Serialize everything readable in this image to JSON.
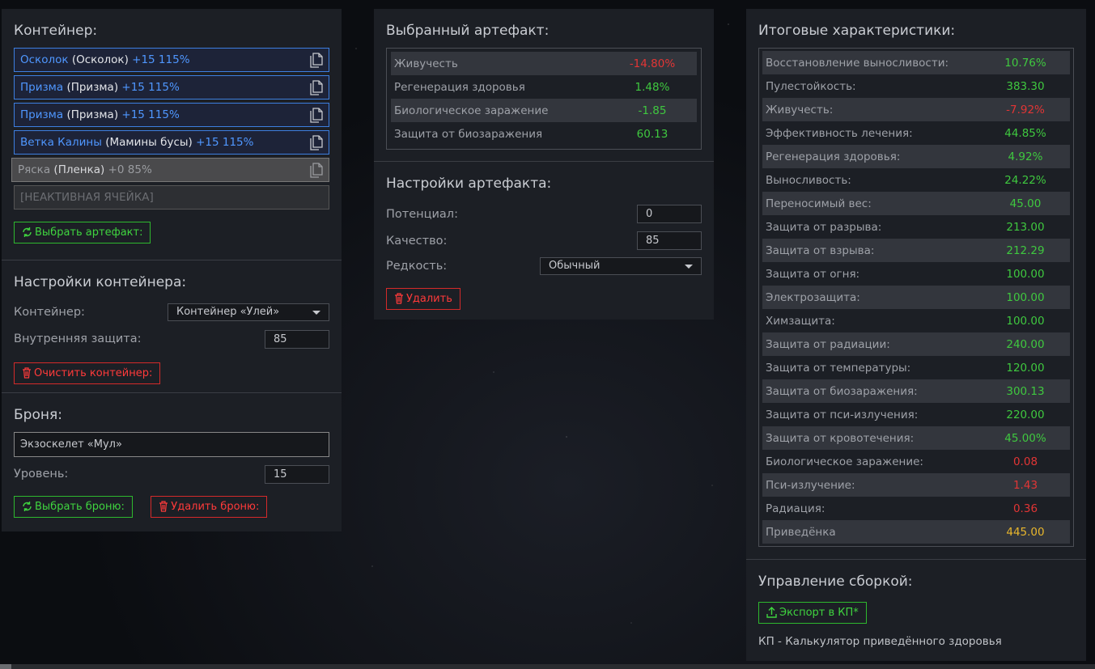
{
  "container_section": {
    "title": "Контейнер:",
    "slots": [
      {
        "name": "Осколок",
        "type": "(Осколок)",
        "bonus": "+15 115%"
      },
      {
        "name": "Призма",
        "type": "(Призма)",
        "bonus": "+15 115%"
      },
      {
        "name": "Призма",
        "type": "(Призма)",
        "bonus": "+15 115%"
      },
      {
        "name": "Ветка Калины",
        "type": "(Мамины бусы)",
        "bonus": "+15 115%"
      },
      {
        "name": "Ряска",
        "type": "(Пленка)",
        "bonus": "+0 85%"
      }
    ],
    "inactive_slot": "[НЕАКТИВНАЯ ЯЧЕЙКА]",
    "choose_artifact_button": "Выбрать артефакт:"
  },
  "container_settings": {
    "title": "Настройки контейнера:",
    "container_label": "Контейнер:",
    "container_value": "Контейнер «Улей»",
    "inner_protection_label": "Внутренняя защита:",
    "inner_protection_value": "85",
    "clear_button": "Очистить контейнер:"
  },
  "armor": {
    "title": "Броня:",
    "name": "Экзоскелет «Мул»",
    "level_label": "Уровень:",
    "level_value": "15",
    "choose_button": "Выбрать броню:",
    "delete_button": "Удалить броню:"
  },
  "selected_artifact": {
    "title": "Выбранный артефакт:",
    "stats": [
      {
        "label": "Живучесть",
        "value": "-14.80%",
        "tone": "neg"
      },
      {
        "label": "Регенерация здоровья",
        "value": "1.48%",
        "tone": "pos"
      },
      {
        "label": "Биологическое заражение",
        "value": "-1.85",
        "tone": "pos"
      },
      {
        "label": "Защита от биозаражения",
        "value": "60.13",
        "tone": "pos"
      }
    ]
  },
  "artifact_settings": {
    "title": "Настройки артефакта:",
    "potential_label": "Потенциал:",
    "potential_value": "0",
    "quality_label": "Качество:",
    "quality_value": "85",
    "rarity_label": "Редкость:",
    "rarity_value": "Обычный",
    "delete_button": "Удалить"
  },
  "totals": {
    "title": "Итоговые характеристики:",
    "stats": [
      {
        "label": "Восстановление выносливости:",
        "value": "10.76%",
        "tone": "pos"
      },
      {
        "label": "Пулестойкость:",
        "value": "383.30",
        "tone": "pos"
      },
      {
        "label": "Живучесть:",
        "value": "-7.92%",
        "tone": "neg"
      },
      {
        "label": "Эффективность лечения:",
        "value": "44.85%",
        "tone": "pos"
      },
      {
        "label": "Регенерация здоровья:",
        "value": "4.92%",
        "tone": "pos"
      },
      {
        "label": "Выносливость:",
        "value": "24.22%",
        "tone": "pos"
      },
      {
        "label": "Переносимый вес:",
        "value": "45.00",
        "tone": "pos"
      },
      {
        "label": "Защита от разрыва:",
        "value": "213.00",
        "tone": "pos"
      },
      {
        "label": "Защита от взрыва:",
        "value": "212.29",
        "tone": "pos"
      },
      {
        "label": "Защита от огня:",
        "value": "100.00",
        "tone": "pos"
      },
      {
        "label": "Электрозащита:",
        "value": "100.00",
        "tone": "pos"
      },
      {
        "label": "Химзащита:",
        "value": "100.00",
        "tone": "pos"
      },
      {
        "label": "Защита от радиации:",
        "value": "240.00",
        "tone": "pos"
      },
      {
        "label": "Защита от температуры:",
        "value": "120.00",
        "tone": "pos"
      },
      {
        "label": "Защита от биозаражения:",
        "value": "300.13",
        "tone": "pos"
      },
      {
        "label": "Защита от пси-излучения:",
        "value": "220.00",
        "tone": "pos"
      },
      {
        "label": "Защита от кровотечения:",
        "value": "45.00%",
        "tone": "pos"
      },
      {
        "label": "Биологическое заражение:",
        "value": "0.08",
        "tone": "neg"
      },
      {
        "label": "Пси-излучение:",
        "value": "1.43",
        "tone": "neg"
      },
      {
        "label": "Радиация:",
        "value": "0.36",
        "tone": "neg"
      },
      {
        "label": "Приведёнка",
        "value": "445.00",
        "tone": "gold"
      }
    ]
  },
  "build_management": {
    "title": "Управление сборкой:",
    "export_button": "Экспорт в КП*",
    "note": "КП - Калькулятор приведённого здоровья"
  },
  "colors": {
    "panel": "#1c1f25",
    "slot_border": "#3d7fe0",
    "positive": "#3fc83f",
    "negative": "#e23535",
    "highlight": "#e8b62c"
  }
}
